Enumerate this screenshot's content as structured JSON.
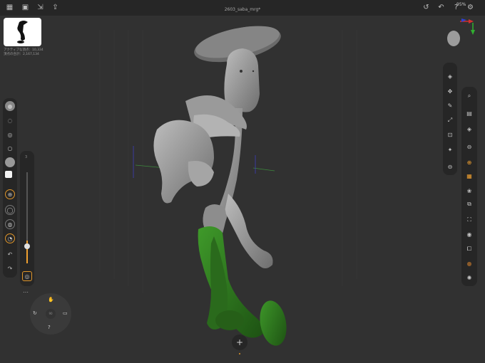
{
  "window": {
    "title": "2603_saba_mrg*",
    "battery": "95%"
  },
  "stats": {
    "active_points": "アクティブな頂点：10,334",
    "total_points": "頂点の合計：2,167,134"
  },
  "left_toolbar": {
    "icons": [
      "sphere-icon",
      "lasso-icon",
      "brush-off-icon",
      "circle-icon",
      "matcap-icon",
      "color-swatch-icon",
      "symmetry-icon",
      "draw-size-icon",
      "draw-intensity-icon",
      "stroke-icon",
      "undo-icon",
      "redo-icon"
    ]
  },
  "slider": {
    "label": "3",
    "level": 0.25
  },
  "right_toolbar_top": [
    "layers-icon",
    "pin-icon",
    "brush-icon",
    "transform-icon",
    "mask-icon",
    "magic-icon",
    "minus-icon"
  ],
  "right_toolbar_main": [
    "search-icon",
    "photo-icon",
    "stack-icon",
    "minus-circle-icon",
    "globe-icon",
    "grid-icon",
    "butterfly-icon",
    "mirror-icon",
    "fit-icon",
    "camera-icon",
    "copy-icon",
    "paint-icon",
    "lightbulb-icon"
  ],
  "nav_wheel": {
    "center": "90"
  },
  "add_button": "+",
  "colors": {
    "accent": "#f0a030",
    "background": "#313131",
    "panel": "#262626",
    "green": "#2f7d1f"
  }
}
